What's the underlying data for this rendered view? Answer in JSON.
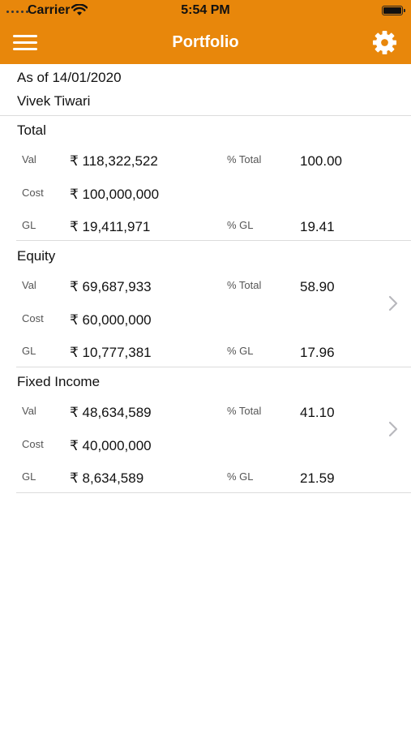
{
  "status_bar": {
    "carrier": "Carrier",
    "time": "5:54 PM"
  },
  "nav": {
    "title": "Portfolio",
    "menu_icon": "hamburger-icon",
    "settings_icon": "gear-icon"
  },
  "header": {
    "as_of": "As of 14/01/2020",
    "user": "Vivek Tiwari"
  },
  "colors": {
    "accent": "#e8870b",
    "separator": "#dcdcdc"
  },
  "sections": [
    {
      "title": "Total",
      "val_label": "Val",
      "val": "₹ 118,322,522",
      "pct_total_label": "% Total",
      "pct_total": "100.00",
      "cost_label": "Cost",
      "cost": "₹ 100,000,000",
      "gl_label": "GL",
      "gl": "₹ 19,411,971",
      "pct_gl_label": "% GL",
      "pct_gl": "19.41"
    },
    {
      "title": "Equity",
      "val_label": "Val",
      "val": "₹ 69,687,933",
      "pct_total_label": "% Total",
      "pct_total": "58.90",
      "cost_label": "Cost",
      "cost": "₹ 60,000,000",
      "gl_label": "GL",
      "gl": "₹ 10,777,381",
      "pct_gl_label": "% GL",
      "pct_gl": "17.96"
    },
    {
      "title": "Fixed Income",
      "val_label": "Val",
      "val": "₹ 48,634,589",
      "pct_total_label": "% Total",
      "pct_total": "41.10",
      "cost_label": "Cost",
      "cost": "₹ 40,000,000",
      "gl_label": "GL",
      "gl": "₹ 8,634,589",
      "pct_gl_label": "% GL",
      "pct_gl": "21.59"
    }
  ]
}
